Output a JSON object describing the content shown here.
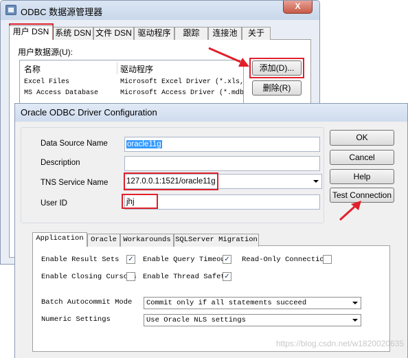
{
  "admin": {
    "title": "ODBC 数据源管理器",
    "close_glyph": "X",
    "tabs": [
      "用户 DSN",
      "系统 DSN",
      "文件 DSN",
      "驱动程序",
      "跟踪",
      "连接池",
      "关于"
    ],
    "active_tab": "用户 DSN",
    "user_dsn_label": "用户数据源(U):",
    "columns": [
      "名称",
      "驱动程序"
    ],
    "rows": [
      [
        "Excel Files",
        "Microsoft Excel Driver (*.xls,"
      ],
      [
        "MS Access Database",
        "Microsoft Access Driver (*.mdb"
      ]
    ],
    "add_button": "添加(D)...",
    "remove_button": "删除(R)"
  },
  "dialog": {
    "title": "Oracle ODBC Driver Configuration",
    "labels": {
      "data_source_name": "Data Source Name",
      "description": "Description",
      "tns_service_name": "TNS Service Name",
      "user_id": "User ID"
    },
    "values": {
      "data_source_name": "oracle11g",
      "description": "",
      "tns_service_name": "127.0.0.1:1521/oracle11g",
      "user_id": "jhj"
    },
    "buttons": {
      "ok": "OK",
      "cancel": "Cancel",
      "help": "Help",
      "test_connection": "Test Connection"
    },
    "tabs": [
      "Application",
      "Oracle",
      "Workarounds",
      "SQLServer Migration"
    ],
    "active_tab": "Application",
    "checkboxes": [
      {
        "label": "Enable Result Sets",
        "checked": true
      },
      {
        "label": "Enable Query Timeout",
        "checked": true
      },
      {
        "label": "Read-Only Connection",
        "checked": false
      },
      {
        "label": "Enable Closing Cursors",
        "checked": false
      },
      {
        "label": "Enable Thread Safety",
        "checked": true
      }
    ],
    "batch_autocommit_label": "Batch Autocommit Mode",
    "batch_autocommit_value": "Commit only if all statements succeed",
    "numeric_settings_label": "Numeric Settings",
    "numeric_settings_value": "Use Oracle NLS settings"
  },
  "watermark": "https://blog.csdn.net/w1820020635",
  "colors": {
    "annotation": "#e0202a",
    "selection": "#3399ff"
  }
}
